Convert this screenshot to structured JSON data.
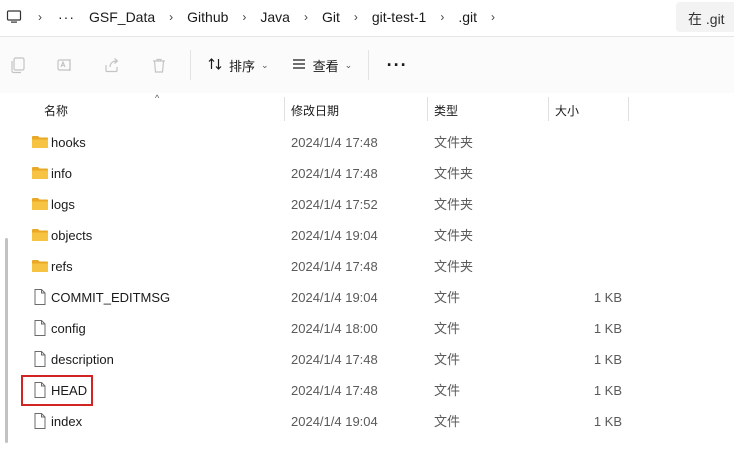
{
  "breadcrumb": {
    "items": [
      "GSF_Data",
      "Github",
      "Java",
      "Git",
      "git-test-1",
      ".git"
    ],
    "overflow": "···"
  },
  "search": {
    "text": "在 .git"
  },
  "toolbar": {
    "sort_label": "排序",
    "view_label": "查看",
    "more_label": "···"
  },
  "columns": {
    "name": "名称",
    "date": "修改日期",
    "type": "类型",
    "size": "大小"
  },
  "files": [
    {
      "name": "hooks",
      "date": "2024/1/4 17:48",
      "type": "文件夹",
      "size": "",
      "kind": "folder"
    },
    {
      "name": "info",
      "date": "2024/1/4 17:48",
      "type": "文件夹",
      "size": "",
      "kind": "folder"
    },
    {
      "name": "logs",
      "date": "2024/1/4 17:52",
      "type": "文件夹",
      "size": "",
      "kind": "folder"
    },
    {
      "name": "objects",
      "date": "2024/1/4 19:04",
      "type": "文件夹",
      "size": "",
      "kind": "folder"
    },
    {
      "name": "refs",
      "date": "2024/1/4 17:48",
      "type": "文件夹",
      "size": "",
      "kind": "folder"
    },
    {
      "name": "COMMIT_EDITMSG",
      "date": "2024/1/4 19:04",
      "type": "文件",
      "size": "1 KB",
      "kind": "file"
    },
    {
      "name": "config",
      "date": "2024/1/4 18:00",
      "type": "文件",
      "size": "1 KB",
      "kind": "file"
    },
    {
      "name": "description",
      "date": "2024/1/4 17:48",
      "type": "文件",
      "size": "1 KB",
      "kind": "file"
    },
    {
      "name": "HEAD",
      "date": "2024/1/4 17:48",
      "type": "文件",
      "size": "1 KB",
      "kind": "file",
      "highlighted": true
    },
    {
      "name": "index",
      "date": "2024/1/4 19:04",
      "type": "文件",
      "size": "1 KB",
      "kind": "file"
    }
  ],
  "colors": {
    "folder": "#f6c343",
    "folder_dark": "#e9a825",
    "highlight": "#d32424"
  },
  "icons": {
    "nav": "computer-icon",
    "toolbar": [
      "copy-icon",
      "rename-icon",
      "share-icon",
      "delete-icon",
      "sort-icon",
      "view-icon"
    ],
    "folder": "folder-icon",
    "file": "file-icon"
  }
}
